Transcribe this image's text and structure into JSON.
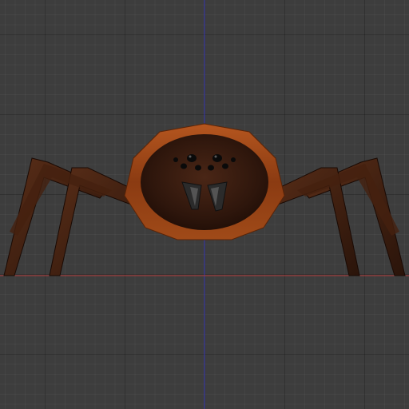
{
  "viewport": {
    "colors": {
      "background": "#3d3d3d",
      "grid_major": "#2b2b2b",
      "grid_minor": "#454545",
      "x_axis": "#b23a3a",
      "z_axis": "#3a3ab2"
    },
    "object": {
      "kind": "spider-mesh",
      "colors": {
        "carapace_rim": "#8a3d14",
        "carapace_rim_light": "#b45a22",
        "body": "#3a1d12",
        "body_dark": "#231008",
        "legs": "#3b1d10",
        "legs_light": "#5a2e18",
        "eyes": "#0a0a0a",
        "fangs": "#2a2a2a",
        "fang_highlight": "#6f6f6f"
      }
    }
  }
}
